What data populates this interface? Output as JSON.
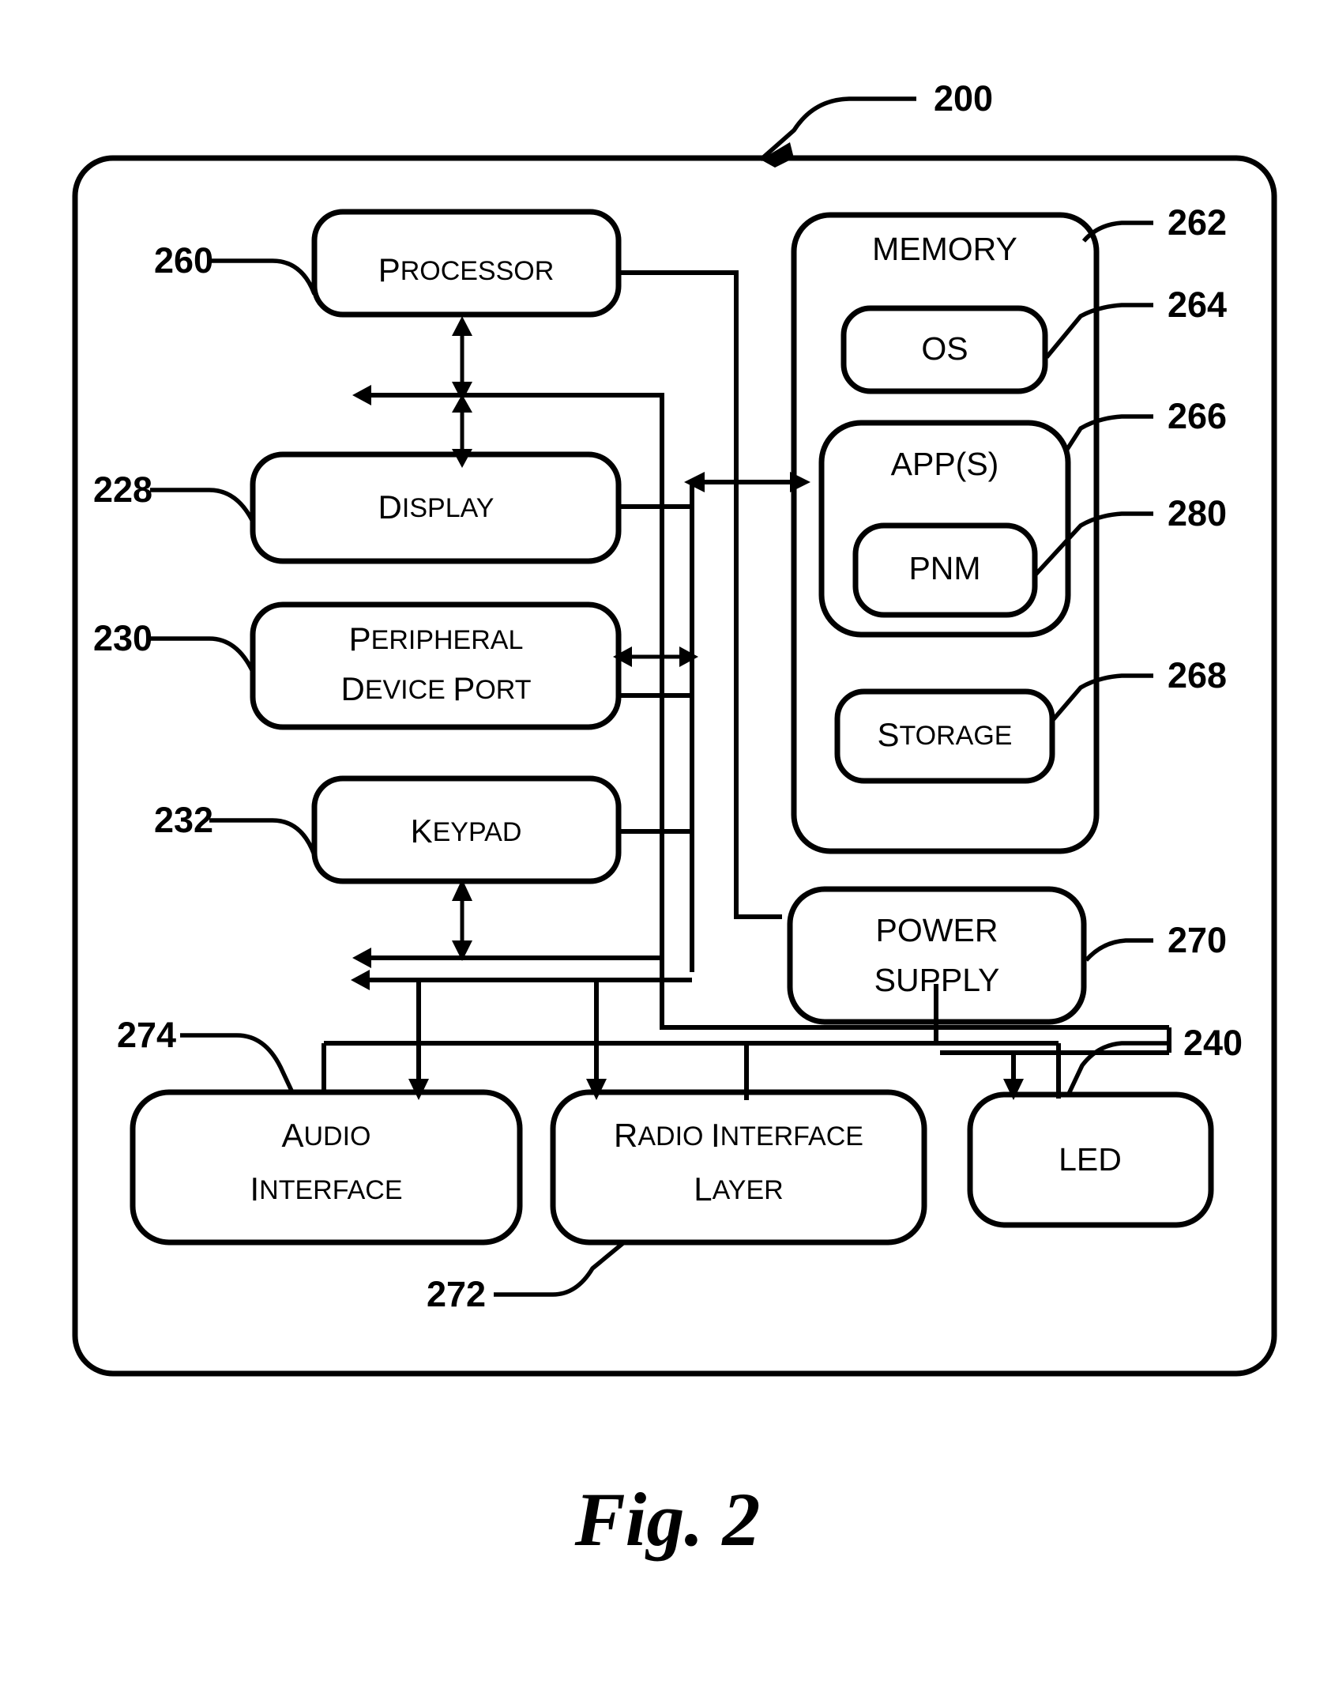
{
  "figure": {
    "caption": "Fig. 2",
    "device_ref": "200"
  },
  "blocks": {
    "processor": {
      "label": "PROCESSOR",
      "ref": "260"
    },
    "display": {
      "label": "DISPLAY",
      "ref": "228"
    },
    "peripheral_device_port": {
      "label_line1": "PERIPHERAL",
      "label_line2": "DEVICE PORT",
      "ref": "230"
    },
    "keypad": {
      "label": "KEYPAD",
      "ref": "232"
    },
    "memory": {
      "label": "MEMORY",
      "ref": "262"
    },
    "os": {
      "label": "OS",
      "ref": "264"
    },
    "apps": {
      "label": "APP(S)",
      "ref": "266"
    },
    "pnm": {
      "label": "PNM",
      "ref": "280"
    },
    "storage": {
      "label": "STORAGE",
      "ref": "268"
    },
    "power_supply": {
      "label_line1": "POWER",
      "label_line2": "SUPPLY",
      "ref": "270"
    },
    "audio_interface": {
      "label_line1": "AUDIO",
      "label_line2": "INTERFACE",
      "ref": "274"
    },
    "radio_interface_layer": {
      "label_line1": "RADIO INTERFACE",
      "label_line2": "LAYER",
      "ref": "272"
    },
    "led": {
      "label": "LED",
      "ref": "240"
    }
  },
  "reference_numerals": [
    {
      "id": "200",
      "value": "200"
    },
    {
      "id": "260",
      "value": "260"
    },
    {
      "id": "228",
      "value": "228"
    },
    {
      "id": "230",
      "value": "230"
    },
    {
      "id": "232",
      "value": "232"
    },
    {
      "id": "262",
      "value": "262"
    },
    {
      "id": "264",
      "value": "264"
    },
    {
      "id": "266",
      "value": "266"
    },
    {
      "id": "280",
      "value": "280"
    },
    {
      "id": "268",
      "value": "268"
    },
    {
      "id": "270",
      "value": "270"
    },
    {
      "id": "274",
      "value": "274"
    },
    {
      "id": "272",
      "value": "272"
    },
    {
      "id": "240",
      "value": "240"
    }
  ],
  "colors": {
    "ink": "#000000",
    "paper": "#ffffff"
  }
}
